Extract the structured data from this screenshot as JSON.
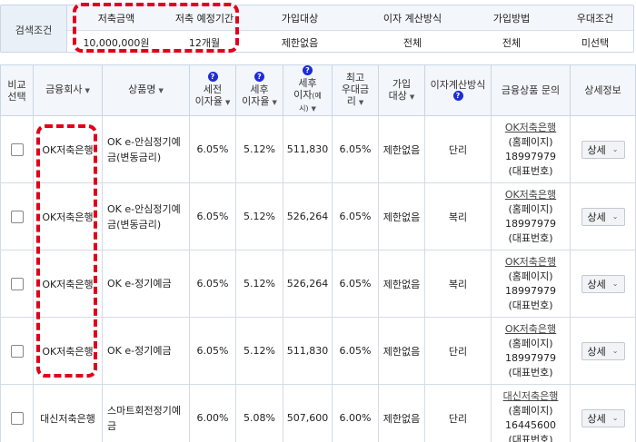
{
  "search": {
    "label": "검색조건",
    "headers": [
      "저축금액",
      "저축 예정기간",
      "가입대상",
      "이자 계산방식",
      "가입방법",
      "우대조건"
    ],
    "values": [
      "10,000,000원",
      "12개월",
      "제한없음",
      "전체",
      "전체",
      "미선택"
    ]
  },
  "table": {
    "headers": {
      "compare": "비교\n선택",
      "company": "금융회사",
      "product": "상품명",
      "pretax": "세전\n이자율",
      "aftertax": "세후\n이자율",
      "aftertax_interest": "세후\n이자",
      "aftertax_interest_note": "(예시)",
      "max_rate": "최고\n우대금\n리",
      "join_target": "가입\n대상",
      "calc_method": "이자계산방식",
      "inquiry": "금융상품 문의",
      "detail": "상세정보"
    },
    "badge": "?",
    "sort_icon": "▼",
    "rows": [
      {
        "company": "OK저축은행",
        "product": "OK e-안심정기예금(변동금리)",
        "pretax": "6.05%",
        "aftertax": "5.12%",
        "interest": "511,830",
        "max_rate": "6.05%",
        "target": "제한없음",
        "method": "단리",
        "inquiry_name": "OK저축은행",
        "inquiry_home": "(홈페이지)",
        "inquiry_phone": "18997979",
        "inquiry_rep": "(대표번호)",
        "detail": "상세"
      },
      {
        "company": "OK저축은행",
        "product": "OK e-안심정기예금(변동금리)",
        "pretax": "6.05%",
        "aftertax": "5.12%",
        "interest": "526,264",
        "max_rate": "6.05%",
        "target": "제한없음",
        "method": "복리",
        "inquiry_name": "OK저축은행",
        "inquiry_home": "(홈페이지)",
        "inquiry_phone": "18997979",
        "inquiry_rep": "(대표번호)",
        "detail": "상세"
      },
      {
        "company": "OK저축은행",
        "product": "OK e-정기예금",
        "pretax": "6.05%",
        "aftertax": "5.12%",
        "interest": "526,264",
        "max_rate": "6.05%",
        "target": "제한없음",
        "method": "복리",
        "inquiry_name": "OK저축은행",
        "inquiry_home": "(홈페이지)",
        "inquiry_phone": "18997979",
        "inquiry_rep": "(대표번호)",
        "detail": "상세"
      },
      {
        "company": "OK저축은행",
        "product": "OK e-정기예금",
        "pretax": "6.05%",
        "aftertax": "5.12%",
        "interest": "511,830",
        "max_rate": "6.05%",
        "target": "제한없음",
        "method": "단리",
        "inquiry_name": "OK저축은행",
        "inquiry_home": "(홈페이지)",
        "inquiry_phone": "18997979",
        "inquiry_rep": "(대표번호)",
        "detail": "상세"
      },
      {
        "company": "대신저축은행",
        "product": "스마트회전정기예금",
        "pretax": "6.00%",
        "aftertax": "5.08%",
        "interest": "507,600",
        "max_rate": "6.00%",
        "target": "제한없음",
        "method": "단리",
        "inquiry_name": "대신저축은행",
        "inquiry_home": "(홈페이지)",
        "inquiry_phone": "16445600",
        "inquiry_rep": "(대표번호)",
        "detail": "상세"
      }
    ]
  }
}
